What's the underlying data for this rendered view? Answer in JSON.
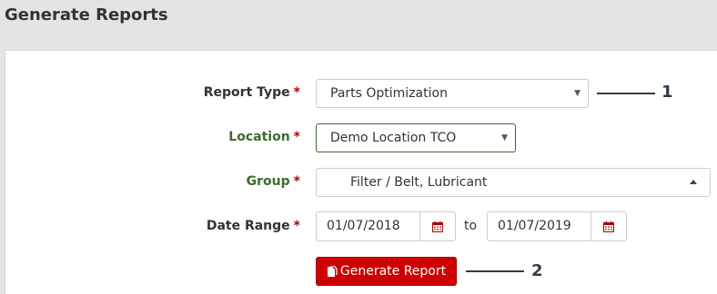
{
  "page": {
    "title": "Generate Reports"
  },
  "form": {
    "report_type": {
      "label": "Report Type",
      "required": "*",
      "value": "Parts Optimization"
    },
    "location": {
      "label": "Location",
      "required": "*",
      "value": "Demo Location TCO"
    },
    "group": {
      "label": "Group",
      "required": "*",
      "value": "Filter / Belt, Lubricant"
    },
    "date_range": {
      "label": "Date Range",
      "required": "*",
      "from": "01/07/2018",
      "separator": "to",
      "to": "01/07/2019"
    },
    "submit_label": "Generate Report"
  },
  "callouts": {
    "first": "1",
    "second": "2"
  },
  "colors": {
    "required": "#b30000",
    "green_label": "#3d6b2e",
    "button": "#cc0000",
    "callout": "#2f3d4d",
    "calendar_icon": "#b30000"
  }
}
